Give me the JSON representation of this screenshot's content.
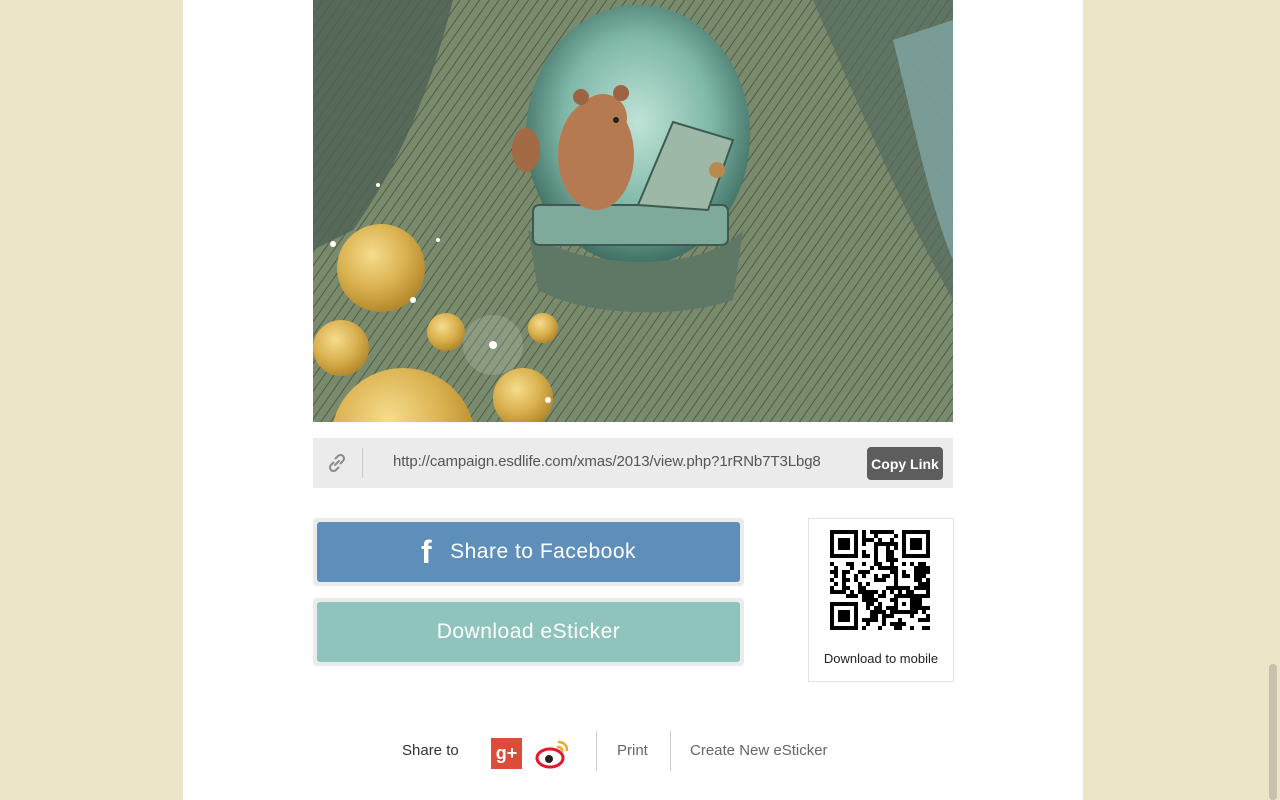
{
  "illustration": {
    "icon": "squirrel-laptop-illustration"
  },
  "link_bar": {
    "icon": "link-icon",
    "url": "http://campaign.esdlife.com/xmas/2013/view.php?1rRNb7T3Lbg8",
    "copy_label": "Copy Link"
  },
  "buttons": {
    "facebook_icon": "f",
    "facebook_label": "Share to Facebook",
    "download_label": "Download eSticker"
  },
  "qr": {
    "caption": "Download to mobile"
  },
  "footer": {
    "share_label": "Share to",
    "gplus_label": "g+",
    "print_label": "Print",
    "create_label": "Create New eSticker"
  },
  "colors": {
    "page_bg": "#ede5c8",
    "facebook": "#5e8fba",
    "download": "#8ec4bb",
    "gplus": "#dd4b39",
    "weibo": "#e6162d"
  }
}
